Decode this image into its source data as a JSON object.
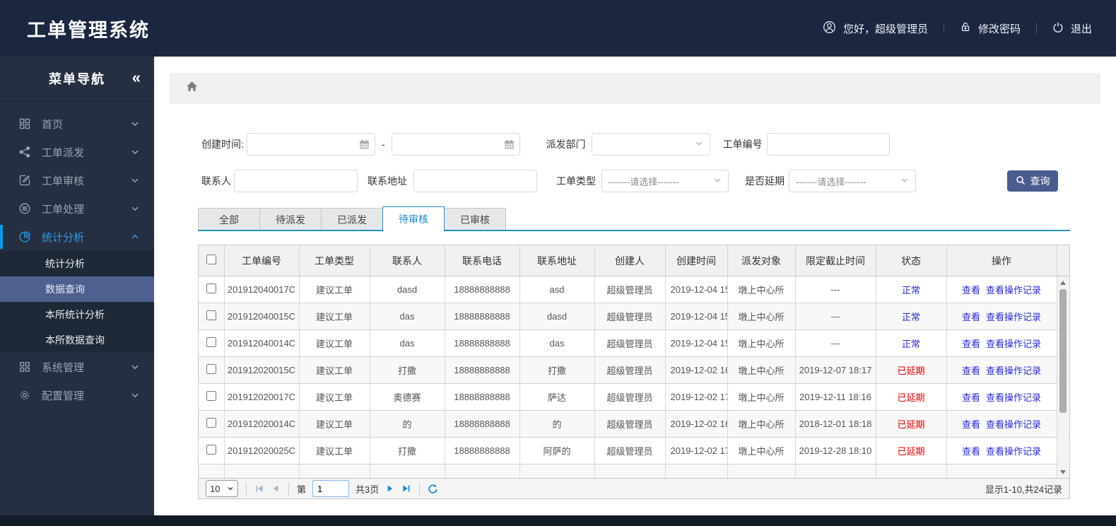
{
  "header": {
    "title": "工单管理系统",
    "greeting": "您好，超级管理员",
    "change_password": "修改密码",
    "logout": "退出"
  },
  "sidebar": {
    "title": "菜单导航",
    "collapse_icon": "«",
    "menu": [
      {
        "label": "首页",
        "icon": "home-grid-icon"
      },
      {
        "label": "工单派发",
        "icon": "share-icon"
      },
      {
        "label": "工单审核",
        "icon": "edit-icon"
      },
      {
        "label": "工单处理",
        "icon": "process-icon"
      },
      {
        "label": "统计分析",
        "icon": "pie-chart-icon",
        "active": true,
        "expanded": true,
        "children": [
          {
            "label": "统计分析"
          },
          {
            "label": "数据查询",
            "active": true
          },
          {
            "label": "本所统计分析"
          },
          {
            "label": "本所数据查询"
          }
        ]
      },
      {
        "label": "系统管理",
        "icon": "modules-icon"
      },
      {
        "label": "配置管理",
        "icon": "gear-icon"
      }
    ]
  },
  "filters": {
    "created_label": "创建时间:",
    "range_separator": "-",
    "created_from_value": "",
    "created_to_value": "",
    "dept_label": "派发部门",
    "dept_value": "",
    "order_no_label": "工单编号",
    "order_no_value": "",
    "contact_label": "联系人",
    "contact_value": "",
    "address_label": "联系地址",
    "address_value": "",
    "type_label": "工单类型",
    "delay_label": "是否延期",
    "select_placeholder": "-------请选择-------",
    "search_button": "查询"
  },
  "tabs": {
    "items": [
      "全部",
      "待派发",
      "已派发",
      "待审核",
      "已审核"
    ],
    "active_index": 3
  },
  "table": {
    "columns": [
      "工单编号",
      "工单类型",
      "联系人",
      "联系电话",
      "联系地址",
      "创建人",
      "创建时间",
      "派发对象",
      "限定截止时间",
      "状态",
      "操作"
    ],
    "op_links": [
      "查看",
      "查看操作记录"
    ],
    "status_colors": {
      "正常": "#2b2bd5",
      "已延期": "#e60000"
    },
    "rows": [
      {
        "order_no": "201912040017C",
        "type": "建议工单",
        "contact": "dasd",
        "phone": "18888888888",
        "address": "asd",
        "creator": "超级管理员",
        "created": "2019-12-04 15",
        "target": "墩上中心所",
        "deadline": "---",
        "status": "正常"
      },
      {
        "order_no": "201912040015C",
        "type": "建议工单",
        "contact": "das",
        "phone": "18888888888",
        "address": "dasd",
        "creator": "超级管理员",
        "created": "2019-12-04 15",
        "target": "墩上中心所",
        "deadline": "---",
        "status": "正常"
      },
      {
        "order_no": "201912040014C",
        "type": "建议工单",
        "contact": "das",
        "phone": "18888888888",
        "address": "das",
        "creator": "超级管理员",
        "created": "2019-12-04 15",
        "target": "墩上中心所",
        "deadline": "---",
        "status": "正常"
      },
      {
        "order_no": "201912020015C",
        "type": "建议工单",
        "contact": "打撒",
        "phone": "18888888888",
        "address": "打撒",
        "creator": "超级管理员",
        "created": "2019-12-02 16",
        "target": "墩上中心所",
        "deadline": "2019-12-07 18:17",
        "status": "已延期"
      },
      {
        "order_no": "201912020017C",
        "type": "建议工单",
        "contact": "奥德赛",
        "phone": "18888888888",
        "address": "萨达",
        "creator": "超级管理员",
        "created": "2019-12-02 17",
        "target": "墩上中心所",
        "deadline": "2019-12-11 18:16",
        "status": "已延期"
      },
      {
        "order_no": "201912020014C",
        "type": "建议工单",
        "contact": "的",
        "phone": "18888888888",
        "address": "的",
        "creator": "超级管理员",
        "created": "2019-12-02 16",
        "target": "墩上中心所",
        "deadline": "2018-12-01 18:18",
        "status": "已延期"
      },
      {
        "order_no": "201912020025C",
        "type": "建议工单",
        "contact": "打撒",
        "phone": "18888888888",
        "address": "阿萨的",
        "creator": "超级管理员",
        "created": "2019-12-02 17",
        "target": "墩上中心所",
        "deadline": "2019-12-28 18:10",
        "status": "已延期"
      }
    ]
  },
  "pagination": {
    "page_size": "10",
    "page_prefix": "第",
    "page_value": "1",
    "total_pages": "共3页",
    "summary": "显示1-10,共24记录"
  },
  "colors": {
    "accent_blue": "#2590cf",
    "button_blue": "#4a5c8f",
    "link_blue": "#2b2bd5",
    "danger_red": "#e60000",
    "header_navy": "#1b2740",
    "sidebar_dark": "#262f41"
  }
}
